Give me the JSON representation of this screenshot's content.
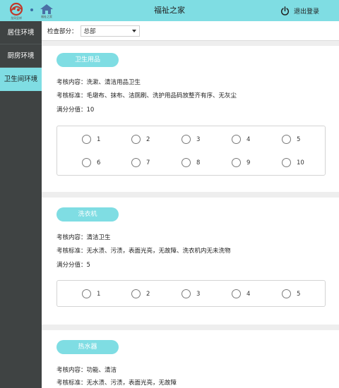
{
  "header": {
    "logo_left_caption": "龙凤呈祥",
    "logo_right_caption": "福祉之家",
    "title": "福祉之家",
    "logout_label": "退出登录",
    "accent_color": "#7fdde3"
  },
  "sidebar": {
    "items": [
      {
        "label": "居住环境",
        "active": false
      },
      {
        "label": "厨房环境",
        "active": false
      },
      {
        "label": "卫生间环境",
        "active": true
      }
    ]
  },
  "filter": {
    "label": "检查部分：",
    "selected": "总部"
  },
  "sections": [
    {
      "tag": "卫生用品",
      "content": "考核内容：洗漱、清洁用品卫生",
      "standard": "考核标准：毛墩布、抹布、洁厕刷、洗护用品码放整齐有序、无灰尘",
      "score": "满分分值：10",
      "options": [
        "1",
        "2",
        "3",
        "4",
        "5",
        "6",
        "7",
        "8",
        "9",
        "10"
      ]
    },
    {
      "tag": "洗衣机",
      "content": "考核内容：清洁卫生",
      "standard": "考核标准：无水渍、污渍，表面光亮，无故障、洗衣机内无未洗物",
      "score": "满分分值：5",
      "options": [
        "1",
        "2",
        "3",
        "4",
        "5"
      ]
    },
    {
      "tag": "热水器",
      "content": "考核内容：功能、清洁",
      "standard": "考核标准：无水渍、污渍，表面光亮，无故障"
    }
  ]
}
